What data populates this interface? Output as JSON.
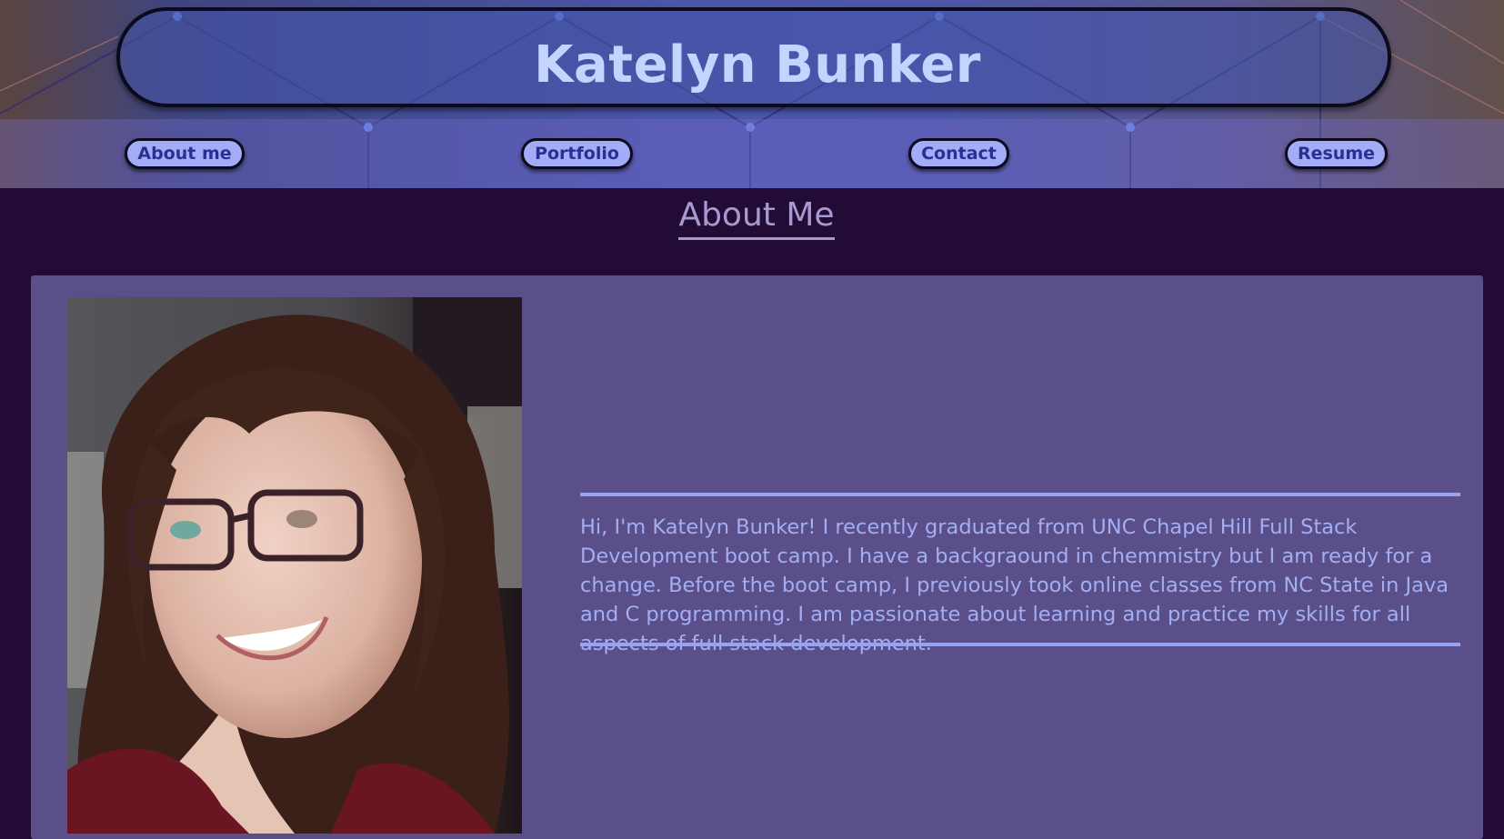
{
  "header": {
    "site_title": "Katelyn Bunker"
  },
  "nav": {
    "items": [
      {
        "label": "About me"
      },
      {
        "label": "Portfolio"
      },
      {
        "label": "Contact"
      },
      {
        "label": "Resume"
      }
    ]
  },
  "about": {
    "heading": "About Me",
    "bio": "Hi, I'm Katelyn Bunker! I recently graduated from UNC Chapel Hill Full Stack Development boot camp. I have a backgraound in chemmistry but I am ready for a change. Before the boot camp, I previously took online classes from NC State in Java and C programming. I am passionate about learning and practice my skills for all aspects of full stack development."
  },
  "colors": {
    "page_background": "#220b35",
    "card_background": "#5a4f88",
    "title_text": "#c3d4ff",
    "nav_button_fill": "#a3adf7",
    "nav_button_text": "#2b2f92",
    "bio_text": "#a3aef5",
    "divider": "#9aa3f2",
    "heading": "#a79ad0"
  }
}
